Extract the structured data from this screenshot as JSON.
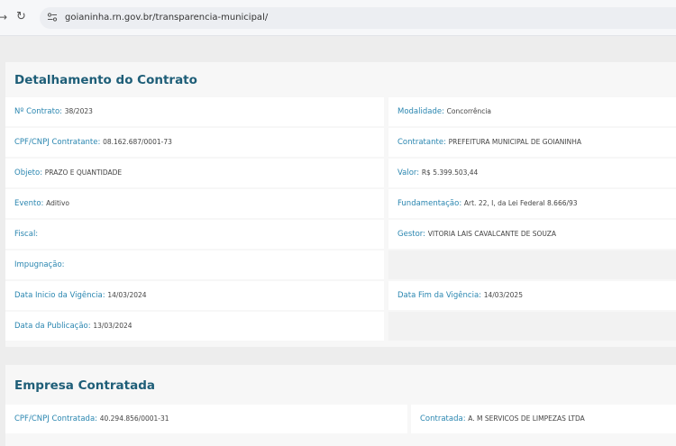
{
  "browser": {
    "url": "goianinha.rn.gov.br/transparencia-municipal/"
  },
  "contract_section": {
    "title": "Detalhamento do Contrato",
    "fields": {
      "numero": {
        "label": "Nº Contrato:",
        "value": "38/2023"
      },
      "modalidade": {
        "label": "Modalidade:",
        "value": "Concorrência"
      },
      "cnpj_contratante": {
        "label": "CPF/CNPJ Contratante:",
        "value": "08.162.687/0001-73"
      },
      "contratante": {
        "label": "Contratante:",
        "value": "PREFEITURA MUNICIPAL DE GOIANINHA"
      },
      "objeto": {
        "label": "Objeto:",
        "value": "PRAZO E QUANTIDADE"
      },
      "valor": {
        "label": "Valor:",
        "value": "R$ 5.399.503,44"
      },
      "evento": {
        "label": "Evento:",
        "value": "Aditivo"
      },
      "fundamentacao": {
        "label": "Fundamentação:",
        "value": "Art. 22, I, da Lei Federal 8.666/93"
      },
      "fiscal": {
        "label": "Fiscal:",
        "value": ""
      },
      "gestor": {
        "label": "Gestor:",
        "value": "VITORIA LAIS CAVALCANTE DE SOUZA"
      },
      "impugnacao": {
        "label": "Impugnação:",
        "value": ""
      },
      "data_inicio": {
        "label": "Data Inicio da Vigência:",
        "value": "14/03/2024"
      },
      "data_fim": {
        "label": "Data Fim da Vigência:",
        "value": "14/03/2025"
      },
      "data_publicacao": {
        "label": "Data da Publicação:",
        "value": "13/03/2024"
      }
    }
  },
  "company_section": {
    "title": "Empresa Contratada",
    "fields": {
      "cnpj_contratada": {
        "label": "CPF/CNPJ Contratada:",
        "value": "40.294.856/0001-31"
      },
      "contratada": {
        "label": "Contratada:",
        "value": "A. M SERVICOS DE LIMPEZAS LTDA"
      }
    }
  }
}
